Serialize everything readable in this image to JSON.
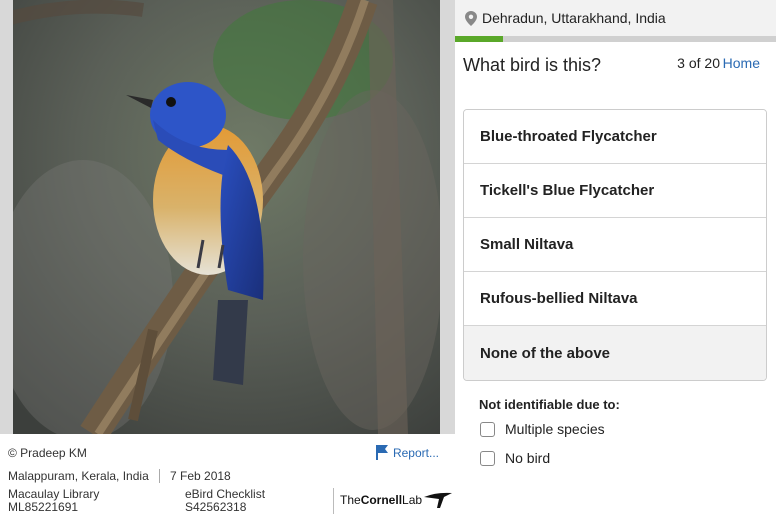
{
  "photo": {
    "credit": "© Pradeep KM",
    "report_label": "Report...",
    "location": "Malappuram, Kerala, India",
    "date": "7 Feb 2018",
    "library_label": "Macaulay Library",
    "library_id": "ML85221691",
    "checklist_label": "eBird Checklist",
    "checklist_id": "S42562318",
    "logo_text_the": "The",
    "logo_text_cornell": "Cornell",
    "logo_text_lab": "Lab"
  },
  "quiz": {
    "region": "Dehradun, Uttarakhand, India",
    "progress_fraction": 0.15,
    "progress_color": "#5aa829",
    "question": "What bird is this?",
    "counter": "3 of 20",
    "home_label": "Home",
    "choices": [
      "Blue-throated Flycatcher",
      "Tickell's Blue Flycatcher",
      "Small Niltava",
      "Rufous-bellied Niltava",
      "None of the above"
    ],
    "not_identifiable_label": "Not identifiable due to:",
    "options": [
      "Multiple species",
      "No bird"
    ]
  },
  "icons": {
    "location": "map-pin-icon",
    "report": "flag-icon",
    "logo": "cornell-lab-bird-icon"
  },
  "colors": {
    "link": "#2a6ab3",
    "progress": "#5aa829"
  }
}
